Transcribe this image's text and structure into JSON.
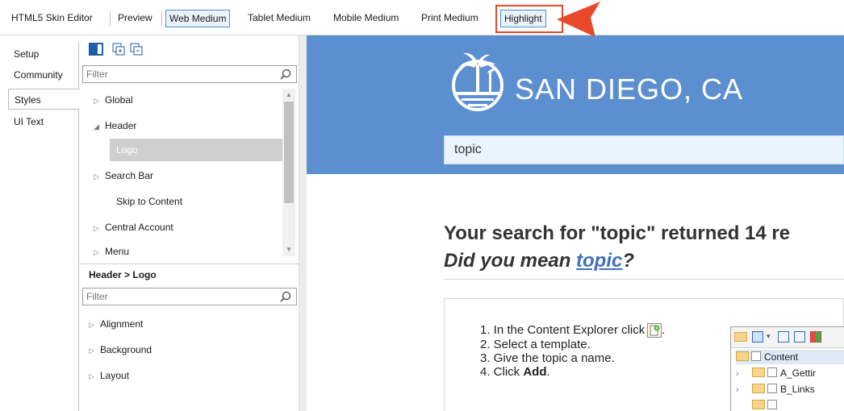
{
  "toolbar": {
    "title": "HTML5 Skin Editor",
    "tabs": [
      "Preview",
      "Web Medium",
      "Tablet Medium",
      "Mobile Medium",
      "Print Medium"
    ],
    "highlight": "Highlight"
  },
  "vertical_tabs": [
    "Setup",
    "Community",
    "Styles",
    "UI Text"
  ],
  "styles_panel": {
    "filter_placeholder": "Filter",
    "tree": [
      {
        "label": "Global",
        "state": "collapsed"
      },
      {
        "label": "Header",
        "state": "expanded"
      },
      {
        "label": "Logo",
        "state": "selected"
      },
      {
        "label": "Search Bar",
        "state": "collapsed"
      },
      {
        "label": "Skip to Content",
        "state": "leaf"
      },
      {
        "label": "Central Account",
        "state": "collapsed"
      },
      {
        "label": "Menu",
        "state": "collapsed"
      }
    ],
    "section_title": "Header > Logo",
    "props_filter_placeholder": "Filter",
    "props": [
      "Alignment",
      "Background",
      "Layout"
    ]
  },
  "preview": {
    "banner_title": "SAN DIEGO, CA",
    "search_value": "topic",
    "result_line1": "Your search for \"topic\" returned 14 re",
    "result_line2_prefix": "Did you mean ",
    "result_line2_link": "topic",
    "result_line2_suffix": "?",
    "steps": [
      "1. In the Content Explorer click",
      "2. Select a template.",
      "3. Give the topic a name.",
      "4. Click "
    ],
    "steps_end_1": ".",
    "step4_bold": "Add",
    "step4_end": ".",
    "explorer": {
      "root": "Content",
      "items": [
        "A_Gettir",
        "B_Links"
      ]
    }
  },
  "colors": {
    "banner": "#5b8fd0",
    "callout": "#e8492a",
    "link": "#3f6fbd",
    "selection": "#cfcfcf"
  }
}
